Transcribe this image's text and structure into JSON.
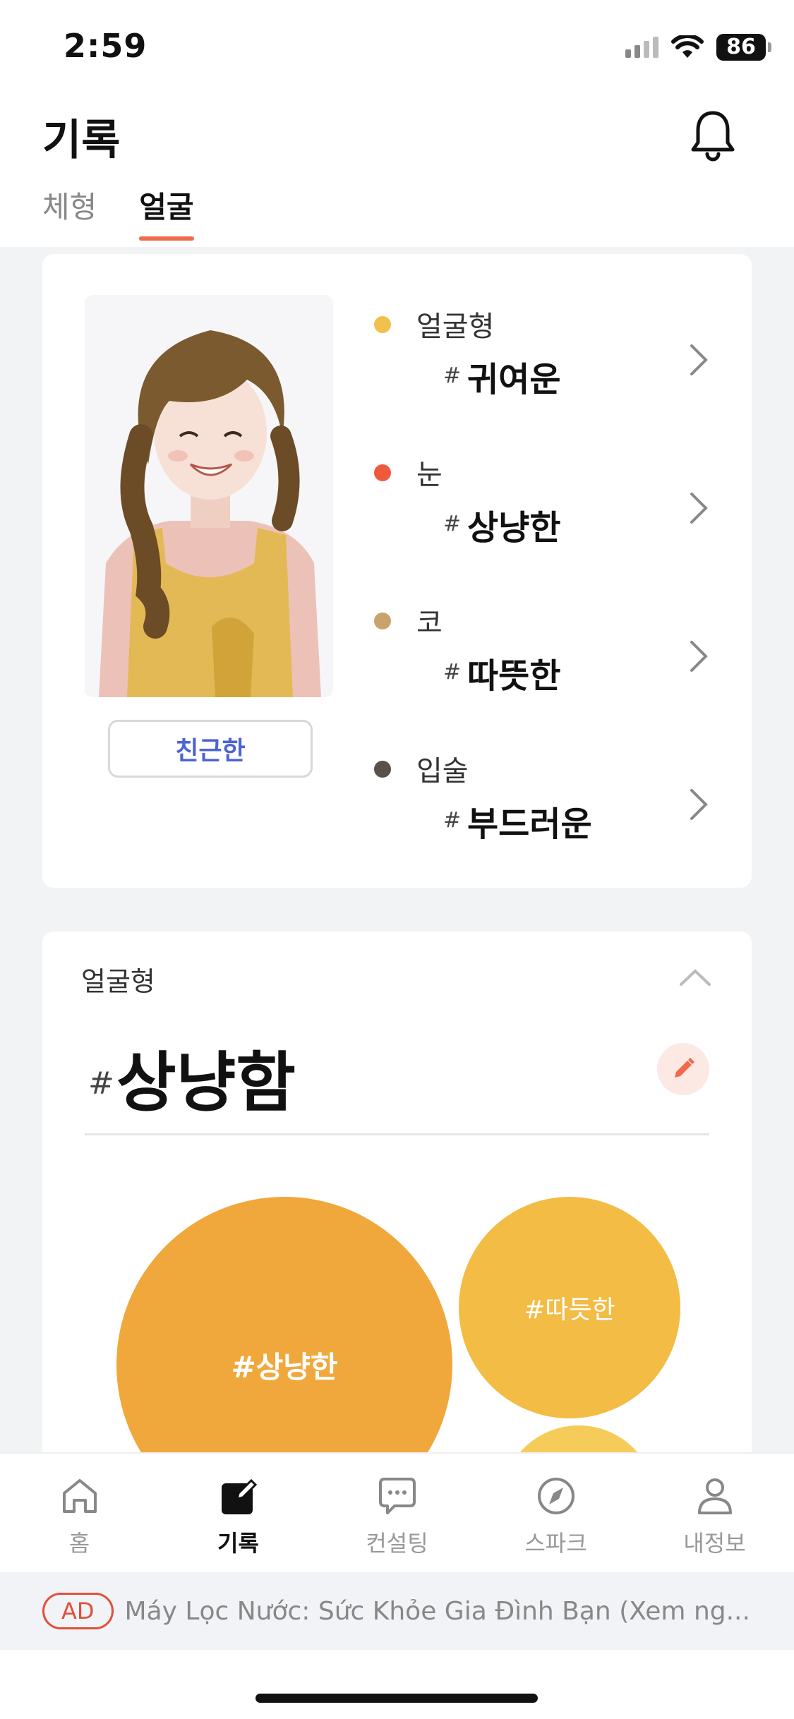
{
  "status_bar": {
    "time": "2:59",
    "battery": "86"
  },
  "header": {
    "title": "기록",
    "tabs": [
      {
        "label": "체형",
        "active": false
      },
      {
        "label": "얼굴",
        "active": true
      }
    ]
  },
  "profile": {
    "type_button": "친근한",
    "features": [
      {
        "label": "얼굴형",
        "hash": "#",
        "value": "귀여운",
        "dot_color": "#f2c04c"
      },
      {
        "label": "눈",
        "hash": "#",
        "value": "상냥한",
        "dot_color": "#f05a3c"
      },
      {
        "label": "코",
        "hash": "#",
        "value": "따뜻한",
        "dot_color": "#c9a36b"
      },
      {
        "label": "입술",
        "hash": "#",
        "value": "부드러운",
        "dot_color": "#5a5048"
      }
    ]
  },
  "detail": {
    "section_title": "얼굴형",
    "hash": "#",
    "main_value": "상냥함",
    "bubbles": [
      {
        "label": "#상냥한",
        "color": "#f0a83c"
      },
      {
        "label": "#따듯한",
        "color": "#f2bc45"
      },
      {
        "label": "",
        "color": "#f5cc5a"
      }
    ]
  },
  "nav": {
    "items": [
      {
        "label": "홈",
        "icon": "home-icon",
        "active": false
      },
      {
        "label": "기록",
        "icon": "edit-note-icon",
        "active": true
      },
      {
        "label": "컨설팅",
        "icon": "chat-bubble-icon",
        "active": false
      },
      {
        "label": "스파크",
        "icon": "compass-icon",
        "active": false
      },
      {
        "label": "내정보",
        "icon": "person-icon",
        "active": false
      }
    ]
  },
  "ad": {
    "badge": "AD",
    "text": "Máy Lọc Nước: Sức Khỏe Gia Đình Bạn (Xem ng..."
  },
  "colors": {
    "accent": "#f06a4d",
    "link_blue": "#4c63d2"
  }
}
